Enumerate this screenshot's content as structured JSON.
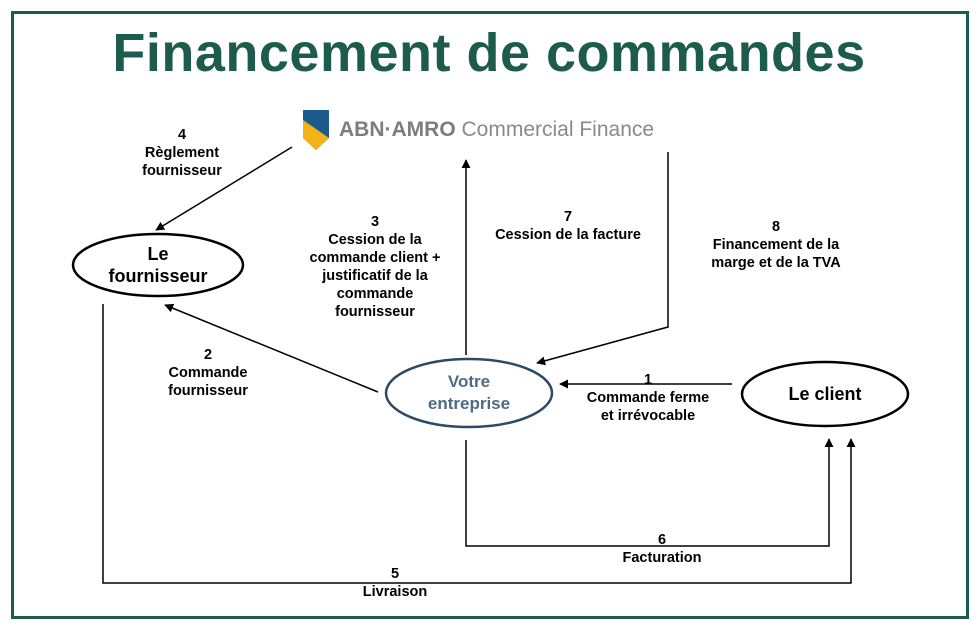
{
  "title": "Financement de commandes",
  "logo": {
    "brand": "ABN·AMRO",
    "text": "Commercial Finance",
    "colors": {
      "blue": "#1d5b8e",
      "yellow": "#f2b316"
    }
  },
  "nodes": {
    "fournisseur": {
      "line1": "Le",
      "line2": "fournisseur"
    },
    "entreprise": {
      "line1": "Votre",
      "line2": "entreprise"
    },
    "client": {
      "text": "Le client"
    }
  },
  "steps": [
    {
      "num": "1",
      "lines": [
        "Commande ferme",
        "et irrévocable"
      ]
    },
    {
      "num": "2",
      "lines": [
        "Commande",
        "fournisseur"
      ]
    },
    {
      "num": "3",
      "lines": [
        "Cession de la",
        "commande client +",
        "justificatif de la",
        "commande",
        "fournisseur"
      ]
    },
    {
      "num": "4",
      "lines": [
        "Règlement",
        "fournisseur"
      ]
    },
    {
      "num": "5",
      "lines": [
        "Livraison"
      ]
    },
    {
      "num": "6",
      "lines": [
        "Facturation"
      ]
    },
    {
      "num": "7",
      "lines": [
        "Cession de la facture"
      ]
    },
    {
      "num": "8",
      "lines": [
        "Financement de la",
        "marge et de la TVA"
      ]
    }
  ],
  "colors": {
    "accent": "#1d5b4c",
    "entreprise_text": "#4f6a86",
    "entreprise_border": "#2b4a66"
  }
}
